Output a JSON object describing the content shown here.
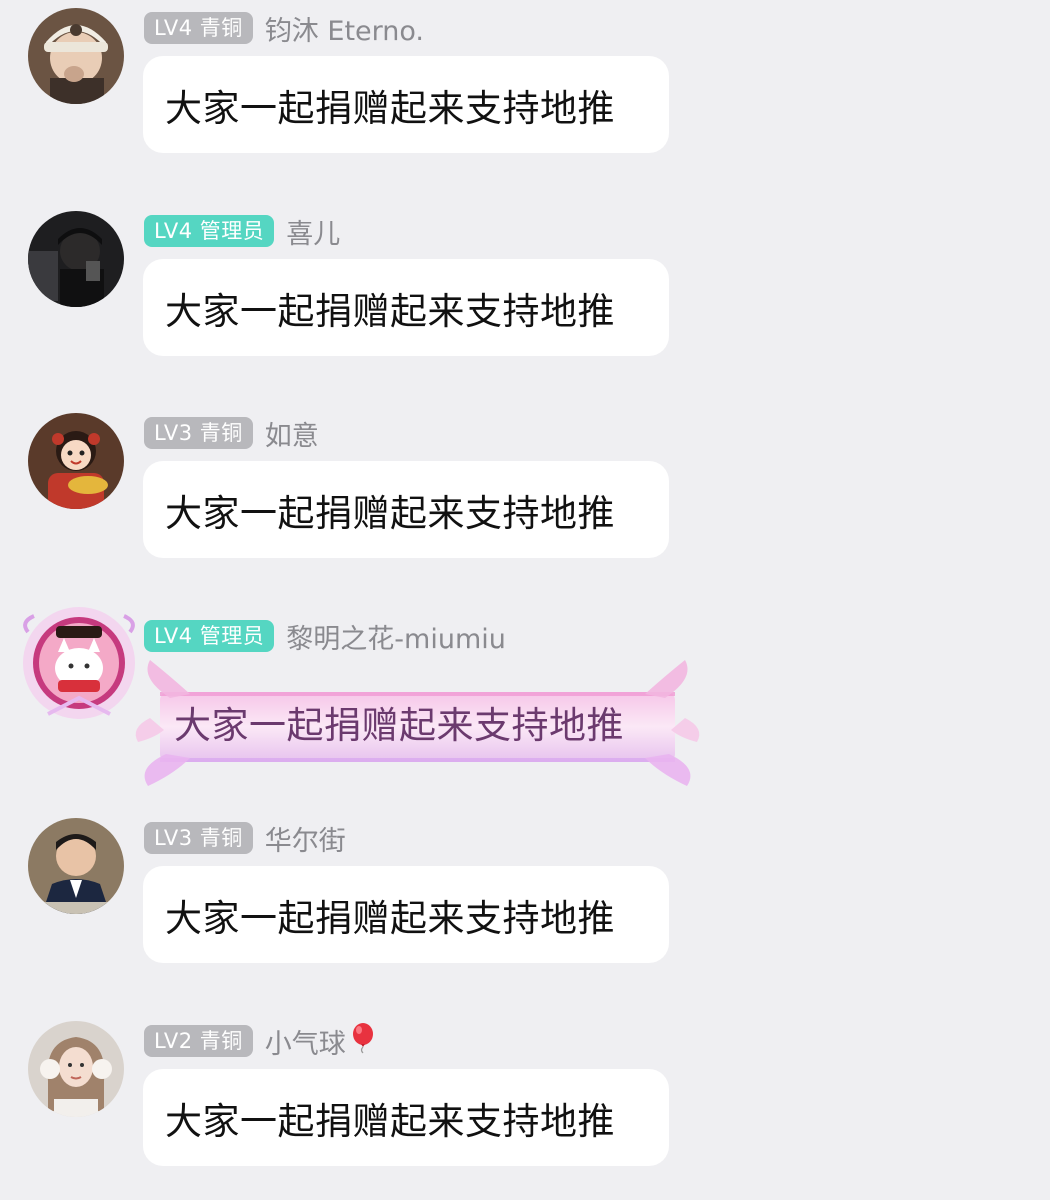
{
  "messages": [
    {
      "badge": "LV4 青铜",
      "badge_type": "bronze",
      "name": "钧沐 Eterno.",
      "text": "大家一起捐赠起来支持地推",
      "avatar": "user-avatar-cap"
    },
    {
      "badge": "LV4 管理员",
      "badge_type": "admin",
      "name": "喜儿",
      "text": "大家一起捐赠起来支持地推",
      "avatar": "user-avatar-dark"
    },
    {
      "badge": "LV3 青铜",
      "badge_type": "bronze",
      "name": "如意",
      "text": "大家一起捐赠起来支持地推",
      "avatar": "user-avatar-cartoon-girl"
    },
    {
      "badge": "LV4 管理员",
      "badge_type": "admin",
      "name": "黎明之花-miumiu",
      "text": "大家一起捐赠起来支持地推",
      "avatar": "user-avatar-lucky-cat"
    },
    {
      "badge": "LV3 青铜",
      "badge_type": "bronze",
      "name": "华尔街",
      "text": "大家一起捐赠起来支持地推",
      "avatar": "user-avatar-man-suit"
    },
    {
      "badge": "LV2 青铜",
      "badge_type": "bronze",
      "name": "小气球",
      "text": "大家一起捐赠起来支持地推",
      "avatar": "user-avatar-woman-headphones",
      "name_icon": "balloon-icon"
    }
  ],
  "colors": {
    "background": "#efeff2",
    "badge_bronze": "#b8b8bc",
    "badge_admin": "#55d6c2",
    "name": "#8a8a8f",
    "bubble": "#ffffff",
    "fancy_text": "#6b3a6e"
  }
}
